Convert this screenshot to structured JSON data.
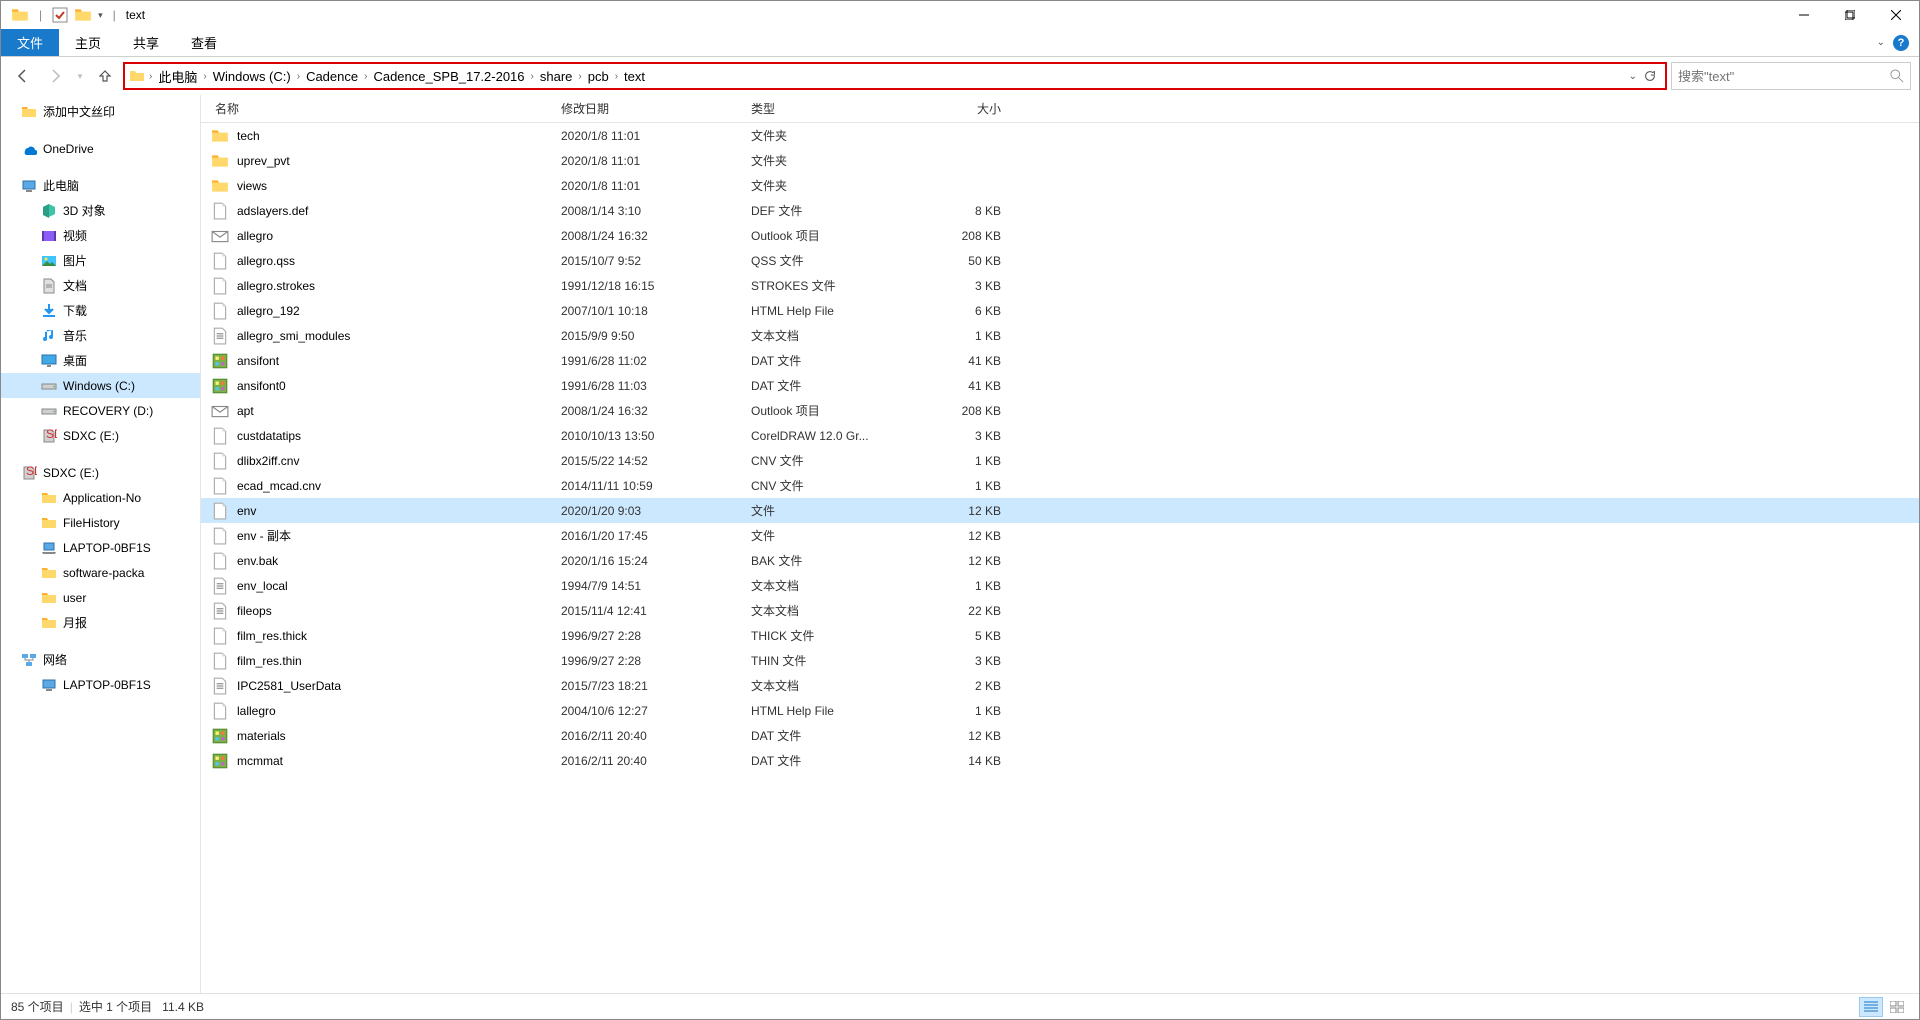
{
  "title": {
    "window_name": "text"
  },
  "ribbon": {
    "file": "文件",
    "home": "主页",
    "share": "共享",
    "view": "查看"
  },
  "breadcrumbs": [
    "此电脑",
    "Windows (C:)",
    "Cadence",
    "Cadence_SPB_17.2-2016",
    "share",
    "pcb",
    "text"
  ],
  "search": {
    "placeholder": "搜索\"text\""
  },
  "sidebar": {
    "items": [
      {
        "label": "添加中文丝印",
        "icon": "folder",
        "indent": false
      },
      {
        "spacer": true
      },
      {
        "label": "OneDrive",
        "icon": "onedrive",
        "indent": false
      },
      {
        "spacer": true
      },
      {
        "label": "此电脑",
        "icon": "thispc",
        "indent": false
      },
      {
        "label": "3D 对象",
        "icon": "3d",
        "indent": true
      },
      {
        "label": "视频",
        "icon": "video",
        "indent": true
      },
      {
        "label": "图片",
        "icon": "pictures",
        "indent": true
      },
      {
        "label": "文档",
        "icon": "documents",
        "indent": true
      },
      {
        "label": "下载",
        "icon": "downloads",
        "indent": true
      },
      {
        "label": "音乐",
        "icon": "music",
        "indent": true
      },
      {
        "label": "桌面",
        "icon": "desktop",
        "indent": true
      },
      {
        "label": "Windows (C:)",
        "icon": "drive",
        "indent": true,
        "selected": true
      },
      {
        "label": "RECOVERY (D:)",
        "icon": "drive",
        "indent": true
      },
      {
        "label": "SDXC (E:)",
        "icon": "sd",
        "indent": true
      },
      {
        "spacer": true
      },
      {
        "label": "SDXC (E:)",
        "icon": "sd",
        "indent": false
      },
      {
        "label": "Application-No",
        "icon": "folder",
        "indent": true
      },
      {
        "label": "FileHistory",
        "icon": "folder",
        "indent": true
      },
      {
        "label": "LAPTOP-0BF1S",
        "icon": "laptop",
        "indent": true
      },
      {
        "label": "software-packa",
        "icon": "folder",
        "indent": true
      },
      {
        "label": "user",
        "icon": "folder",
        "indent": true
      },
      {
        "label": "月报",
        "icon": "folder",
        "indent": true
      },
      {
        "spacer": true
      },
      {
        "label": "网络",
        "icon": "network",
        "indent": false
      },
      {
        "label": "LAPTOP-0BF1S",
        "icon": "computer",
        "indent": true
      }
    ]
  },
  "columns": {
    "name": "名称",
    "date": "修改日期",
    "type": "类型",
    "size": "大小"
  },
  "files": [
    {
      "name": "tech",
      "date": "2020/1/8 11:01",
      "type": "文件夹",
      "size": "",
      "icon": "folder"
    },
    {
      "name": "uprev_pvt",
      "date": "2020/1/8 11:01",
      "type": "文件夹",
      "size": "",
      "icon": "folder"
    },
    {
      "name": "views",
      "date": "2020/1/8 11:01",
      "type": "文件夹",
      "size": "",
      "icon": "folder"
    },
    {
      "name": "adslayers.def",
      "date": "2008/1/14 3:10",
      "type": "DEF 文件",
      "size": "8 KB",
      "icon": "file"
    },
    {
      "name": "allegro",
      "date": "2008/1/24 16:32",
      "type": "Outlook 项目",
      "size": "208 KB",
      "icon": "mail"
    },
    {
      "name": "allegro.qss",
      "date": "2015/10/7 9:52",
      "type": "QSS 文件",
      "size": "50 KB",
      "icon": "file"
    },
    {
      "name": "allegro.strokes",
      "date": "1991/12/18 16:15",
      "type": "STROKES 文件",
      "size": "3 KB",
      "icon": "file"
    },
    {
      "name": "allegro_192",
      "date": "2007/10/1 10:18",
      "type": "HTML Help File",
      "size": "6 KB",
      "icon": "file"
    },
    {
      "name": "allegro_smi_modules",
      "date": "2015/9/9 9:50",
      "type": "文本文档",
      "size": "1 KB",
      "icon": "text"
    },
    {
      "name": "ansifont",
      "date": "1991/6/28 11:02",
      "type": "DAT 文件",
      "size": "41 KB",
      "icon": "dat"
    },
    {
      "name": "ansifont0",
      "date": "1991/6/28 11:03",
      "type": "DAT 文件",
      "size": "41 KB",
      "icon": "dat"
    },
    {
      "name": "apt",
      "date": "2008/1/24 16:32",
      "type": "Outlook 项目",
      "size": "208 KB",
      "icon": "mail"
    },
    {
      "name": "custdatatips",
      "date": "2010/10/13 13:50",
      "type": "CorelDRAW 12.0 Gr...",
      "size": "3 KB",
      "icon": "file"
    },
    {
      "name": "dlibx2iff.cnv",
      "date": "2015/5/22 14:52",
      "type": "CNV 文件",
      "size": "1 KB",
      "icon": "file"
    },
    {
      "name": "ecad_mcad.cnv",
      "date": "2014/11/11 10:59",
      "type": "CNV 文件",
      "size": "1 KB",
      "icon": "file"
    },
    {
      "name": "env",
      "date": "2020/1/20 9:03",
      "type": "文件",
      "size": "12 KB",
      "icon": "file",
      "selected": true
    },
    {
      "name": "env - 副本",
      "date": "2016/1/20 17:45",
      "type": "文件",
      "size": "12 KB",
      "icon": "file"
    },
    {
      "name": "env.bak",
      "date": "2020/1/16 15:24",
      "type": "BAK 文件",
      "size": "12 KB",
      "icon": "file"
    },
    {
      "name": "env_local",
      "date": "1994/7/9 14:51",
      "type": "文本文档",
      "size": "1 KB",
      "icon": "text"
    },
    {
      "name": "fileops",
      "date": "2015/11/4 12:41",
      "type": "文本文档",
      "size": "22 KB",
      "icon": "text"
    },
    {
      "name": "film_res.thick",
      "date": "1996/9/27 2:28",
      "type": "THICK 文件",
      "size": "5 KB",
      "icon": "file"
    },
    {
      "name": "film_res.thin",
      "date": "1996/9/27 2:28",
      "type": "THIN 文件",
      "size": "3 KB",
      "icon": "file"
    },
    {
      "name": "IPC2581_UserData",
      "date": "2015/7/23 18:21",
      "type": "文本文档",
      "size": "2 KB",
      "icon": "text"
    },
    {
      "name": "lallegro",
      "date": "2004/10/6 12:27",
      "type": "HTML Help File",
      "size": "1 KB",
      "icon": "file"
    },
    {
      "name": "materials",
      "date": "2016/2/11 20:40",
      "type": "DAT 文件",
      "size": "12 KB",
      "icon": "dat"
    },
    {
      "name": "mcmmat",
      "date": "2016/2/11 20:40",
      "type": "DAT 文件",
      "size": "14 KB",
      "icon": "dat"
    }
  ],
  "status": {
    "items": "85 个项目",
    "selected": "选中 1 个项目",
    "size": "11.4 KB"
  }
}
